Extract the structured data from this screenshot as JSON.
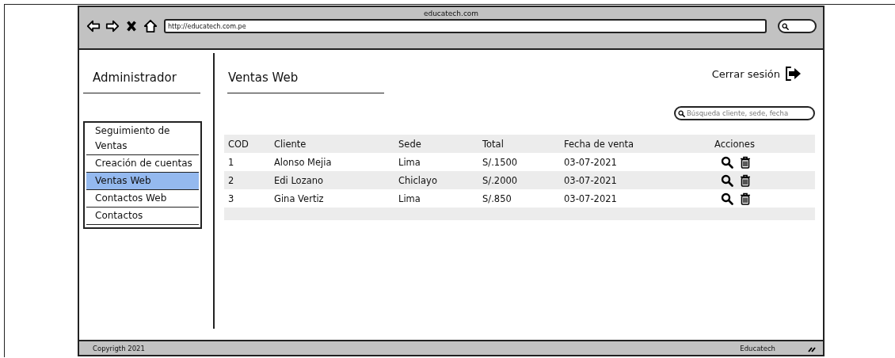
{
  "window": {
    "title": "educatech.com",
    "url": "http://educatech.com.pe"
  },
  "sidebar": {
    "title": "Administrador",
    "items": [
      {
        "label": "Seguimiento de Ventas",
        "selected": false
      },
      {
        "label": "Creación de cuentas",
        "selected": false
      },
      {
        "label": "Ventas Web",
        "selected": true
      },
      {
        "label": "Contactos Web",
        "selected": false
      },
      {
        "label": "Contactos",
        "selected": false
      }
    ]
  },
  "main": {
    "title": "Ventas Web",
    "logout": "Cerrar sesión",
    "search": {
      "placeholder": "Búsqueda cliente, sede, fecha"
    }
  },
  "table": {
    "columns": [
      "COD",
      "Cliente",
      "Sede",
      "Total",
      "Fecha de venta",
      "Acciones"
    ],
    "rows": [
      {
        "cod": "1",
        "cliente": "Alonso Mejia",
        "sede": "Lima",
        "total": "S/.1500",
        "fecha": "03-07-2021"
      },
      {
        "cod": "2",
        "cliente": "Edi Lozano",
        "sede": "Chiclayo",
        "total": "S/.2000",
        "fecha": "03-07-2021"
      },
      {
        "cod": "3",
        "cliente": "Gina Vertiz",
        "sede": "Lima",
        "total": "S/.850",
        "fecha": "03-07-2021"
      }
    ]
  },
  "status_bar": {
    "left": "Copyrigth 2021",
    "right": "Educatech"
  }
}
